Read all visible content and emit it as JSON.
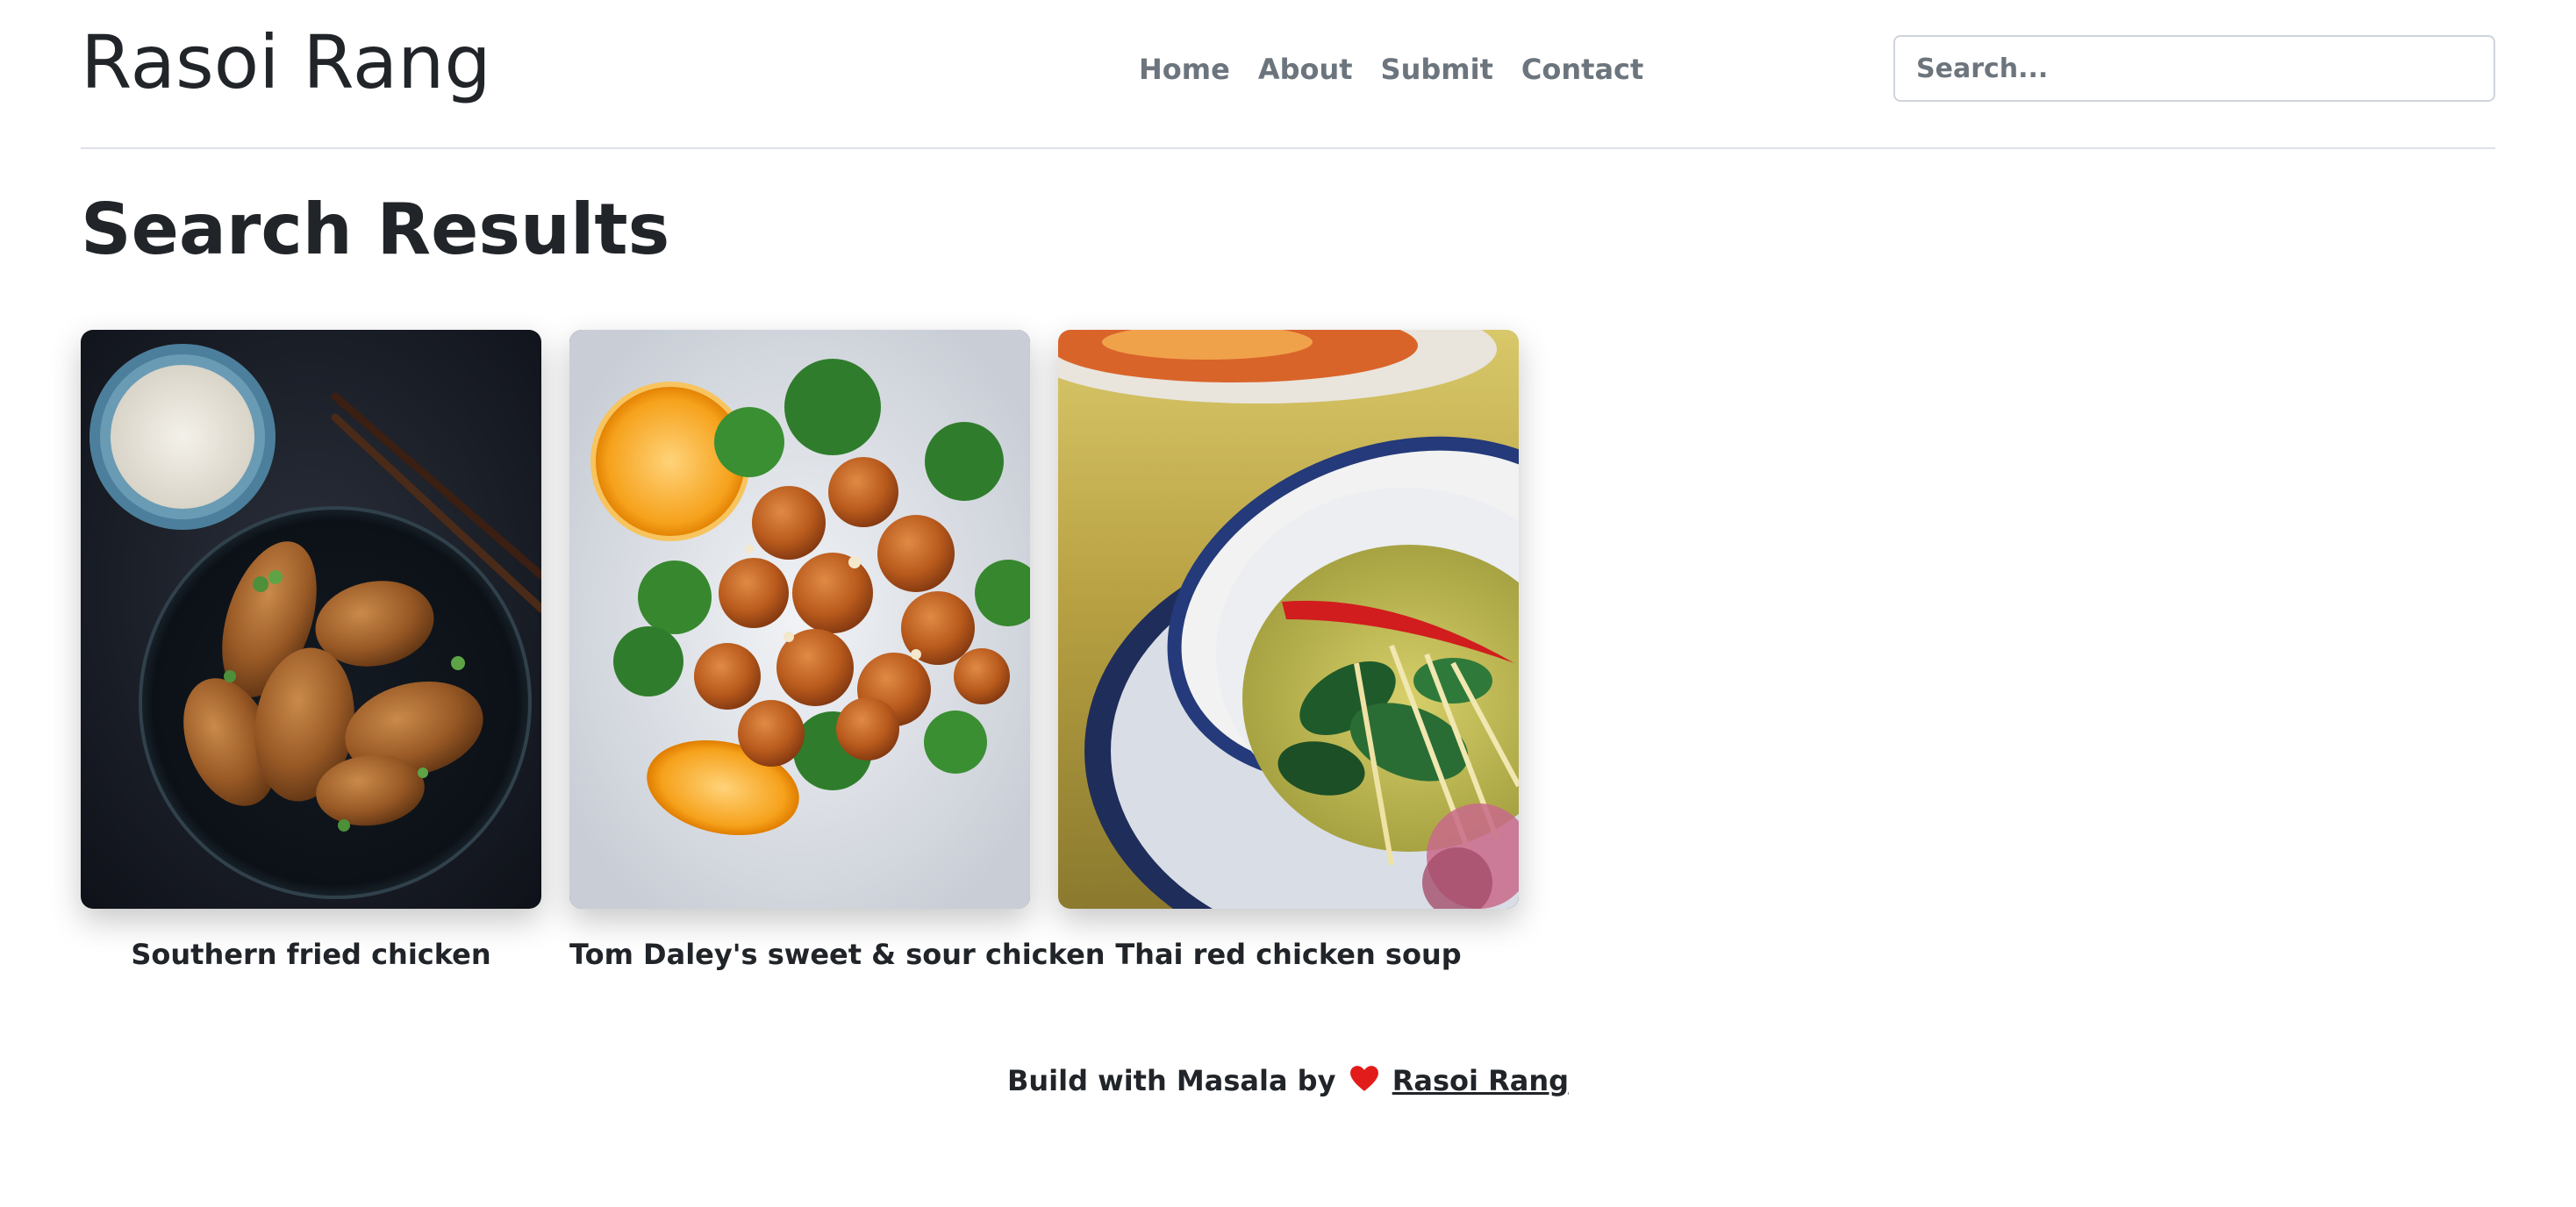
{
  "header": {
    "brand": "Rasoi Rang",
    "nav": [
      {
        "label": "Home"
      },
      {
        "label": "About"
      },
      {
        "label": "Submit"
      },
      {
        "label": "Contact"
      }
    ],
    "search": {
      "placeholder": "Search...",
      "value": ""
    }
  },
  "main": {
    "title": "Search Results",
    "results": [
      {
        "title": "Southern fried chicken",
        "image": "fried-chicken-wings-photo"
      },
      {
        "title": "Tom Daley's sweet & sour chicken",
        "image": "sweet-sour-chicken-photo"
      },
      {
        "title": "Thai red chicken soup",
        "image": "thai-soup-bowl-photo"
      }
    ]
  },
  "footer": {
    "prefix": "Build with Masala by",
    "icon": "heart-icon",
    "link_label": "Rasoi Rang",
    "heart_color": "#e21b1b"
  }
}
